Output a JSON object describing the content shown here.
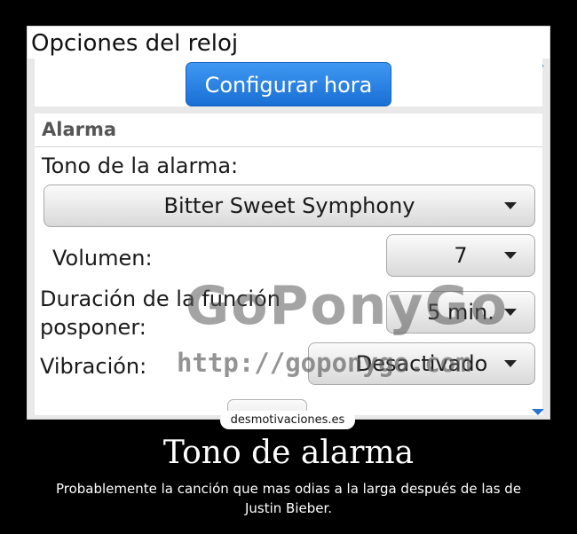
{
  "screen": {
    "title": "Opciones del reloj",
    "config_button": "Configurar hora",
    "section": "Alarma",
    "tone_label": "Tono de la alarma:",
    "tone_value": "Bitter Sweet Symphony",
    "volume_label": "Volumen:",
    "volume_value": "7",
    "snooze_label_line1": "Duración de la función",
    "snooze_label_line2": "posponer:",
    "snooze_value": "5 min.",
    "vibration_label": "Vibración:",
    "vibration_value": "Desactivado"
  },
  "watermark": {
    "brand": "GoPonyGo",
    "url": "http://goponygo.com"
  },
  "poster": {
    "site": "desmotivaciones.es",
    "title": "Tono de alarma",
    "text": "Probablemente la canción que mas odias a la larga después de las de Justin Bieber."
  },
  "colors": {
    "accent": "#2a74d4",
    "background": "#000000"
  }
}
